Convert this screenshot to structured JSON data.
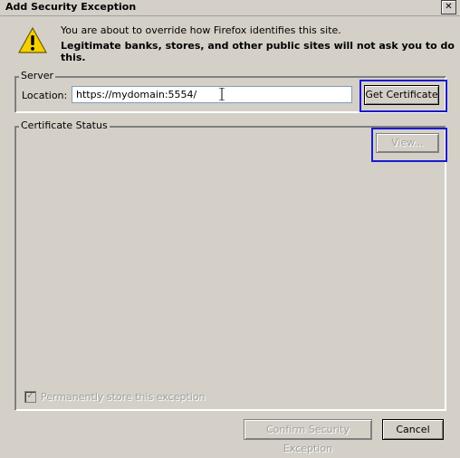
{
  "window": {
    "title": "Add Security Exception",
    "close_glyph": "✕"
  },
  "message": {
    "line1": "You are about to override how Firefox identifies this site.",
    "line2": "Legitimate banks, stores, and other public sites will not ask you to do this."
  },
  "server": {
    "legend": "Server",
    "location_label": "Location:",
    "location_value": "https://mydomain:5554/",
    "get_certificate_label": "Get Certificate"
  },
  "certificate_status": {
    "legend": "Certificate Status",
    "view_label": "View..."
  },
  "permanent": {
    "label": "Permanently store this exception",
    "checked": true
  },
  "footer": {
    "confirm_label": "Confirm Security Exception",
    "cancel_label": "Cancel"
  },
  "colors": {
    "dialog_bg": "#d4d0c8",
    "highlight": "#1a1ad0",
    "warning_yellow": "#f5d000"
  },
  "icons": {
    "warning": "warning-icon",
    "close": "close-icon",
    "text_cursor": "text-cursor-icon"
  }
}
